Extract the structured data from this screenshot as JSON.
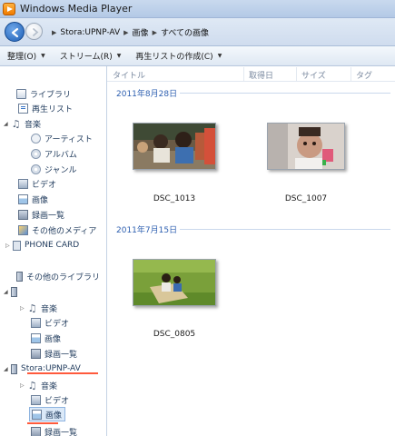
{
  "window": {
    "title": "Windows Media Player"
  },
  "breadcrumb": [
    "Stora:UPNP-AV",
    "画像",
    "すべての画像"
  ],
  "menu": [
    {
      "label": "整理(O)"
    },
    {
      "label": "ストリーム(R)"
    },
    {
      "label": "再生リストの作成(C)"
    },
    {
      "label": ""
    }
  ],
  "nav": {
    "library": "ライブラリ",
    "playlist": "再生リスト",
    "music": "音楽",
    "artist": "アーティスト",
    "album": "アルバム",
    "genre": "ジャンル",
    "video": "ビデオ",
    "pictures": "画像",
    "recorded_tv": "録画一覧",
    "other_media": "その他のメディア",
    "phone_card": "PHONE CARD",
    "other_libraries": "その他のライブラリ",
    "sub1": {
      "music": "音楽",
      "video": "ビデオ",
      "pictures": "画像",
      "recorded_tv": "録画一覧"
    },
    "stora": {
      "name": "Stora:UPNP-AV",
      "music": "音楽",
      "video": "ビデオ",
      "pictures": "画像",
      "recorded_tv": "録画一覧"
    }
  },
  "columns": [
    "タイトル",
    "取得日",
    "サイズ",
    "タグ"
  ],
  "groups": [
    {
      "date": "2011年8月28日",
      "items": [
        {
          "name": "DSC_1013"
        },
        {
          "name": "DSC_1007"
        }
      ]
    },
    {
      "date": "2011年7月15日",
      "items": [
        {
          "name": "DSC_0805"
        }
      ]
    }
  ],
  "colors": {
    "accent": "#2d5fb0",
    "highlight": "#ff5a3c",
    "selection": "#dbe9f8"
  },
  "icons": {
    "app": "media-player-icon",
    "back": "back-arrow-icon",
    "forward": "forward-arrow-icon",
    "library": "library-icon",
    "playlist": "playlist-icon",
    "music": "music-note-icon",
    "artist": "artist-icon",
    "album": "album-icon",
    "genre": "genre-icon",
    "video": "video-icon",
    "pictures": "picture-icon",
    "recorded_tv": "tv-icon",
    "other_media": "media-icon",
    "phone_card": "phone-icon",
    "server": "media-server-icon"
  }
}
